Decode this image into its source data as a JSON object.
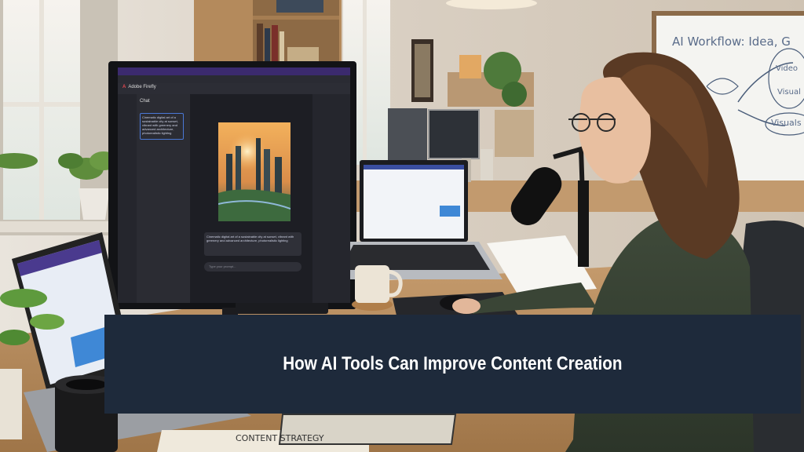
{
  "caption": {
    "title": "How AI Tools Can Improve Content Creation"
  },
  "monitor": {
    "app_name": "Adobe Firefly",
    "brand_mark": "A",
    "chat_title": "Chat",
    "prompt_text": "Cinematic digital art of a sustainable city at sunset, vibrant with greenery and advanced architecture, photorealistic lighting",
    "message_text": "Cinematic digital art of a sustainable city at sunset, vibrant with greenery and advanced architecture, photorealistic lighting",
    "compose_placeholder": "Type your prompt..."
  },
  "whiteboard": {
    "heading": "AI Workflow: Idea, G",
    "node_video": "Video",
    "node_visual": "Visual",
    "node_visuals": "Visuals"
  },
  "notebook": {
    "cover_text": "CONTENT STRATEGY"
  },
  "colors": {
    "caption_band": "#1e2a3b",
    "caption_text": "#ffffff",
    "app_accent": "#4a78d6"
  }
}
